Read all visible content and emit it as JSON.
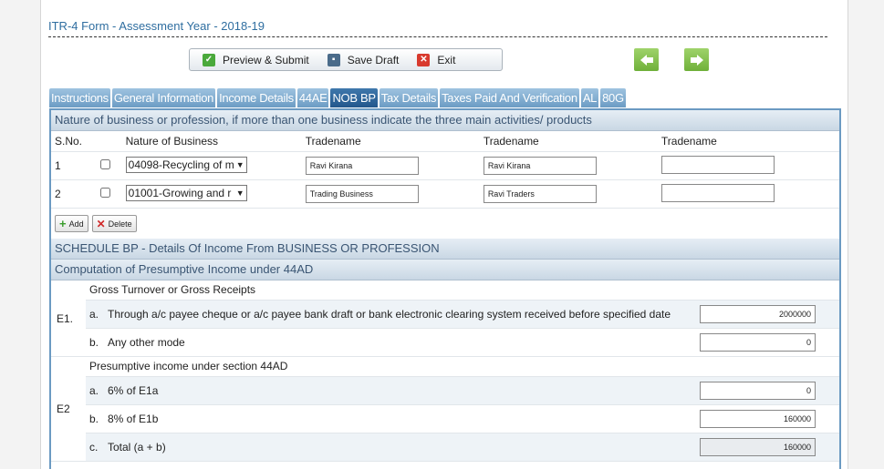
{
  "form": {
    "title": "ITR-4 Form - Assessment Year - 2018-19"
  },
  "toolbar": {
    "preview": "Preview & Submit",
    "save": "Save Draft",
    "exit": "Exit"
  },
  "tabs": [
    "Instructions",
    "General Information",
    "Income Details",
    "44AE",
    "NOB BP",
    "Tax Details",
    "Taxes Paid And Verification",
    "AL",
    "80G"
  ],
  "active_tab": "NOB BP",
  "nob": {
    "header": "Nature of business or profession, if more than one business indicate the three main activities/ products",
    "columns": {
      "sno": "S.No.",
      "nature": "Nature of Business",
      "trade1": "Tradename",
      "trade2": "Tradename",
      "trade3": "Tradename"
    },
    "rows": [
      {
        "sno": "1",
        "nature": "04098-Recycling of m",
        "trade1": "Ravi Kirana",
        "trade2": "Ravi Kirana",
        "trade3": ""
      },
      {
        "sno": "2",
        "nature": "01001-Growing and r",
        "trade1": "Trading Business",
        "trade2": "Ravi Traders",
        "trade3": ""
      }
    ],
    "add_label": "Add",
    "delete_label": "Delete"
  },
  "schedule_bp": {
    "header": "SCHEDULE BP - Details Of Income From BUSINESS OR PROFESSION"
  },
  "computation": {
    "header": "Computation of Presumptive Income under 44AD",
    "e1": {
      "label": "E1.",
      "title": "Gross Turnover or Gross Receipts",
      "a_letter": "a.",
      "a_text": "Through a/c payee cheque or a/c payee bank draft or bank electronic clearing system received before specified date",
      "a_value": "2000000",
      "b_letter": "b.",
      "b_text": "Any other mode",
      "b_value": "0"
    },
    "e2": {
      "label": "E2",
      "title": "Presumptive income under section 44AD",
      "a_letter": "a.",
      "a_text": "6% of E1a",
      "a_value": "0",
      "b_letter": "b.",
      "b_text": "8% of E1b",
      "b_value": "160000",
      "c_letter": "c.",
      "c_text": "Total (a + b)",
      "c_value": "160000"
    }
  },
  "colors": {
    "tab": "#7ba7cc",
    "tab_active": "#2f66a0",
    "section_text": "#3a5573",
    "nav_arrow": "#7fbf45"
  },
  "icons": {
    "preview": "check-icon",
    "save": "floppy-icon",
    "exit": "x-icon",
    "prev": "arrow-left-icon",
    "next": "arrow-right-icon",
    "add": "plus-icon",
    "delete": "x-icon"
  }
}
